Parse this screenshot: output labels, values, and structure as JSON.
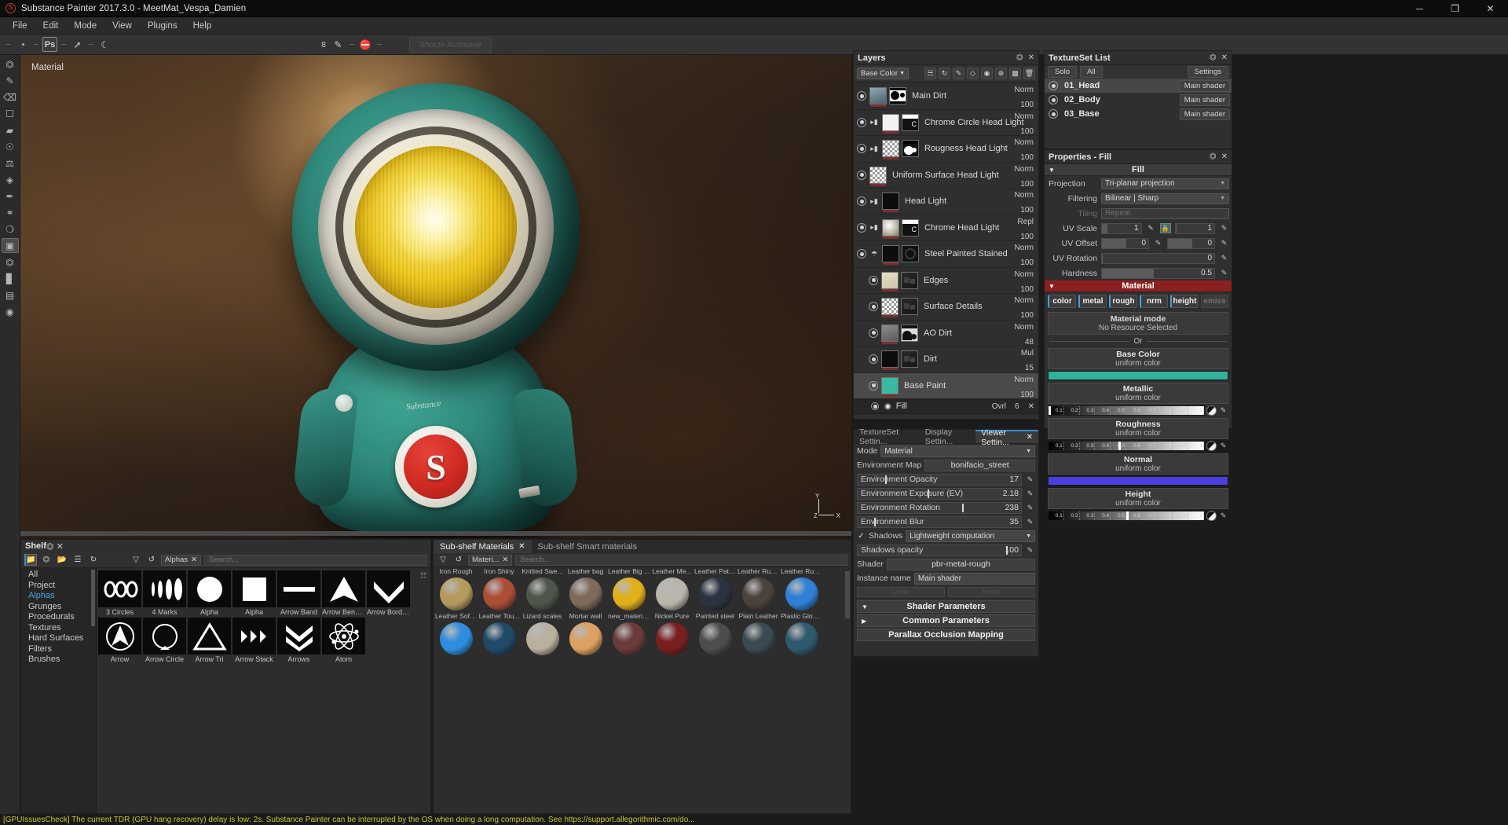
{
  "window": {
    "title": "Substance Painter 2017.3.0 - MeetMat_Vespa_Damien",
    "logo_icon": "substance-logo-icon",
    "minimize": "─",
    "maximize": "❐",
    "close": "✕"
  },
  "menubar": {
    "items": [
      "File",
      "Edit",
      "Mode",
      "View",
      "Plugins",
      "Help"
    ]
  },
  "toolbar": {
    "left_icons": [
      "substance-icon",
      "photoshop-icon",
      "transform-icon",
      "moon-icon"
    ],
    "ps_label": "Ps",
    "brush_size": "8",
    "right_icons": [
      "brush-icon",
      "no-symbol-icon"
    ],
    "autosave_label": "Shoсte Autosave"
  },
  "rail": {
    "icons": [
      "select-rect-icon",
      "paint-brush-icon",
      "eraser-icon",
      "projection-icon",
      "polygon-fill-icon",
      "smudge-icon",
      "clone-stamp-icon",
      "material-picker-icon",
      "eyedropper-icon",
      "physical-paint-icon",
      "particle-icon",
      "geometry-decal-icon",
      "camera-icon",
      "baking-icon",
      "render-icon",
      "texture-set-icon",
      "capture-icon"
    ]
  },
  "viewport": {
    "mode_label": "Material",
    "badge_letter": "S",
    "body_text": "Substance",
    "axis": {
      "x": "X",
      "y": "Y",
      "z": "Z"
    }
  },
  "layers": {
    "title": "Layers",
    "maximize_icon": "maximize-icon",
    "close_icon": "close-icon",
    "channel": "Base Color",
    "toolbar_icons": [
      "add-mask-icon",
      "add-generator-icon",
      "paint-mask-icon",
      "add-fill-layer-icon",
      "add-paint-layer-icon",
      "add-group-icon",
      "duplicate-layer-icon",
      "delete-layer-icon"
    ],
    "items": [
      {
        "name": "Main Dirt",
        "blend": "Norm",
        "opacity": "100",
        "eye": true,
        "folder": false,
        "thumb": "image",
        "mask": "shapes",
        "selected": false,
        "indent": false
      },
      {
        "name": "Chrome Circle Head Light",
        "blend": "Norm",
        "opacity": "100",
        "eye": true,
        "folder": true,
        "thumb": "white",
        "mask": "letter",
        "selected": false,
        "indent": false
      },
      {
        "name": "Rougness Head Light",
        "blend": "Norm",
        "opacity": "100",
        "eye": true,
        "folder": true,
        "thumb": "checker",
        "mask": "blobs",
        "selected": false,
        "indent": false
      },
      {
        "name": "Uniform Surface Head Light",
        "blend": "Norm",
        "opacity": "100",
        "eye": true,
        "folder": false,
        "thumb": "checker",
        "mask": "none",
        "selected": false,
        "indent": false
      },
      {
        "name": "Head Light",
        "blend": "Norm",
        "opacity": "100",
        "eye": true,
        "folder": true,
        "thumb": "black",
        "mask": "none",
        "selected": false,
        "indent": false
      },
      {
        "name": "Chrome Head Light",
        "blend": "Repl",
        "opacity": "100",
        "eye": true,
        "folder": true,
        "thumb": "chrome",
        "mask": "letter",
        "selected": false,
        "indent": false
      },
      {
        "name": "Steel Painted Stained",
        "blend": "Norm",
        "opacity": "100",
        "eye": true,
        "folder": "smart",
        "thumb": "black",
        "mask": "circle",
        "selected": false,
        "indent": false
      },
      {
        "name": "Edges",
        "blend": "Norm",
        "opacity": "100",
        "eye": true,
        "folder": false,
        "thumb": "beige",
        "mask": "dark",
        "selected": false,
        "indent": true
      },
      {
        "name": "Surface Details",
        "blend": "Norm",
        "opacity": "100",
        "eye": true,
        "folder": false,
        "thumb": "checker",
        "mask": "dark",
        "selected": false,
        "indent": true
      },
      {
        "name": "AO Dirt",
        "blend": "Norm",
        "opacity": "48",
        "eye": true,
        "folder": false,
        "thumb": "gray",
        "mask": "aoshapes",
        "selected": false,
        "indent": true
      },
      {
        "name": "Dirt",
        "blend": "Mul",
        "opacity": "15",
        "eye": true,
        "folder": false,
        "thumb": "black",
        "mask": "dark",
        "selected": false,
        "indent": true
      },
      {
        "name": "Base Paint",
        "blend": "Norm",
        "opacity": "100",
        "eye": true,
        "folder": false,
        "thumb": "teal",
        "mask": "none",
        "selected": true,
        "indent": true
      }
    ],
    "sublayer": {
      "name": "Fill",
      "icon": "fill-drop-icon",
      "blend": "Ovrl",
      "opacity": "6",
      "close": "✕"
    }
  },
  "textureset": {
    "title": "TextureSet List",
    "solo_label": "Solo",
    "all_label": "All",
    "settings_label": "Settings",
    "rows": [
      {
        "name": "01_Head",
        "shader": "Main shader",
        "selected": true
      },
      {
        "name": "02_Body",
        "shader": "Main shader",
        "selected": false
      },
      {
        "name": "03_Base",
        "shader": "Main shader",
        "selected": false
      }
    ]
  },
  "properties": {
    "title": "Properties - Fill",
    "section_fill": "Fill",
    "projection_label": "Projection",
    "projection_value": "Tri-planar projection",
    "filtering_label": "Filtering",
    "filtering_value": "Bilinear | Sharp",
    "tiling_label": "Tiling",
    "tiling_value": "Repeat",
    "uvscale_label": "UV Scale",
    "uvscale_u": "1",
    "uvscale_v": "1",
    "uvoffset_label": "UV Offset",
    "uvoffset_u": "0",
    "uvoffset_v": "0",
    "uvrotation_label": "UV Rotation",
    "uvrotation_value": "0",
    "hardness_label": "Hardness",
    "hardness_value": "0.5",
    "material_header": "Material",
    "channels": [
      {
        "label": "color",
        "on": true
      },
      {
        "label": "metal",
        "on": true
      },
      {
        "label": "rough",
        "on": true
      },
      {
        "label": "nrm",
        "on": true
      },
      {
        "label": "height",
        "on": true
      },
      {
        "label": "emiss",
        "on": false
      }
    ],
    "material_mode": "Material mode",
    "no_resource": "No Resource Selected",
    "or_label": "Or",
    "base_color": {
      "title": "Base Color",
      "sub": "uniform color",
      "hex": "#32b29a"
    },
    "metallic": {
      "title": "Metallic",
      "sub": "uniform color",
      "value": 0.0
    },
    "roughness": {
      "title": "Roughness",
      "sub": "uniform color",
      "value": 0.45
    },
    "normal": {
      "title": "Normal",
      "sub": "uniform color",
      "hex": "#4b3fe0"
    },
    "height": {
      "title": "Height",
      "sub": "uniform color",
      "value": 0.5
    },
    "grad_ticks": [
      "0.1",
      "0.2",
      "0.3",
      "0.4",
      "0.5",
      "0.6",
      "0.7",
      "0.8",
      "0.9",
      "1"
    ]
  },
  "viewer": {
    "tabs": [
      {
        "label": "TextureSet Settin...",
        "active": false
      },
      {
        "label": "Display Settin...",
        "active": false
      },
      {
        "label": "Viewer Settin...",
        "active": true
      }
    ],
    "mode_label": "Mode",
    "mode_value": "Material",
    "env_map_label": "Environment Map",
    "env_map_value": "bonifacio_street",
    "sliders": [
      {
        "label": "Environment Opacity",
        "value": "17",
        "pct": 17
      },
      {
        "label": "Environment Exposure (EV)",
        "value": "2.18",
        "pct": 43
      },
      {
        "label": "Environment Rotation",
        "value": "238",
        "pct": 64
      },
      {
        "label": "Environment Blur",
        "value": "35",
        "pct": 10
      }
    ],
    "shadows_label": "Shadows",
    "shadows_value": "Lightweight computation",
    "shadows_opacity_label": "Shadows opacity",
    "shadows_opacity_value": "100",
    "shader_label": "Shader",
    "shader_value": "pbr-metal-rough",
    "instance_label": "Instance name",
    "instance_value": "Main shader",
    "undo_label": "Undo",
    "redo_label": "Redo",
    "shader_params": "Shader Parameters",
    "common_params": "Common Parameters",
    "parallax": "Parallax Occlusion Mapping"
  },
  "shelf": {
    "title": "Shelf",
    "toolbar_icons": [
      "folder-icon",
      "import-icon",
      "new-folder-icon",
      "list-view-icon",
      "refresh-icon"
    ],
    "filter_icon": "filter-icon",
    "reset_icon": "reset-icon",
    "active_chip": "Alphas",
    "chip_close": "✕",
    "search_placeholder": "Search...",
    "categories": [
      {
        "label": "All",
        "active": false
      },
      {
        "label": "Project",
        "active": false
      },
      {
        "label": "Alphas",
        "active": true
      },
      {
        "label": "Grunges",
        "active": false
      },
      {
        "label": "Procedurals",
        "active": false
      },
      {
        "label": "Textures",
        "active": false
      },
      {
        "label": "Hard Surfaces",
        "active": false
      },
      {
        "label": "Filters",
        "active": false
      },
      {
        "label": "Brushes",
        "active": false
      }
    ],
    "items": [
      {
        "label": "3 Circles",
        "glyph": "circles"
      },
      {
        "label": "4 Marks",
        "glyph": "marks"
      },
      {
        "label": "Alpha",
        "glyph": "disc"
      },
      {
        "label": "Alpha",
        "glyph": "square"
      },
      {
        "label": "Arrow Band",
        "glyph": "band"
      },
      {
        "label": "Arrow Bend ...",
        "glyph": "bend"
      },
      {
        "label": "Arrow Borde...",
        "glyph": "chevron"
      },
      {
        "label": "Arrow",
        "glyph": "arrowup"
      },
      {
        "label": "Arrow Circle",
        "glyph": "arrowcircle"
      },
      {
        "label": "Arrow Tri",
        "glyph": "triangle"
      },
      {
        "label": "Arrow Stack",
        "glyph": "stack"
      },
      {
        "label": "Arrows",
        "glyph": "chevrons"
      },
      {
        "label": "Atom",
        "glyph": "atom"
      }
    ]
  },
  "subshelf": {
    "tabs": [
      {
        "label": "Sub-shelf Materials",
        "active": true
      },
      {
        "label": "Sub-shelf Smart materials",
        "active": false
      }
    ],
    "tab_close": "✕",
    "chip": "Materi...",
    "chip_close": "✕",
    "search_placeholder": "Search...",
    "row_top_labels": [
      "Iron Rough",
      "Iron Shiny",
      "Knitted Swe...",
      "Leather bag",
      "Leather Big ...",
      "Leather Me...",
      "Leather Patt...",
      "Leather Rug...",
      "Leather Rug..."
    ],
    "rows": [
      {
        "labels": [
          "Leather Soft...",
          "Leather Tou...",
          "Lizard scales",
          "Mortar wall",
          "new_materia...",
          "Nickel Pure",
          "Painted steel",
          "Plain Leather",
          "Plastic Gloss..."
        ],
        "colors": [
          "#b49a5c",
          "#ab4e36",
          "#4e554a",
          "#7d6a5a",
          "#e0b019",
          "#b9b5ab",
          "#2c3240",
          "#4a423c",
          "#2f7fd6"
        ]
      },
      {
        "labels": [
          "",
          "",
          "",
          "",
          "",
          "",
          "",
          "",
          ""
        ],
        "colors": [
          "#2e8ddd",
          "#1f4a68",
          "#b9b19d",
          "#dca060",
          "#6b3a3a",
          "#7a1f1f",
          "#4d4d4d",
          "#3a4a52",
          "#2f5a6e"
        ]
      }
    ]
  },
  "statusbar": {
    "text": "[GPUIssuesCheck] The current TDR (GPU hang recovery) delay is low: 2s. Substance Painter can be interrupted by the OS when doing a long computation. See https://support.allegorithmic.com/do...",
    "color": "#c9c62e"
  }
}
